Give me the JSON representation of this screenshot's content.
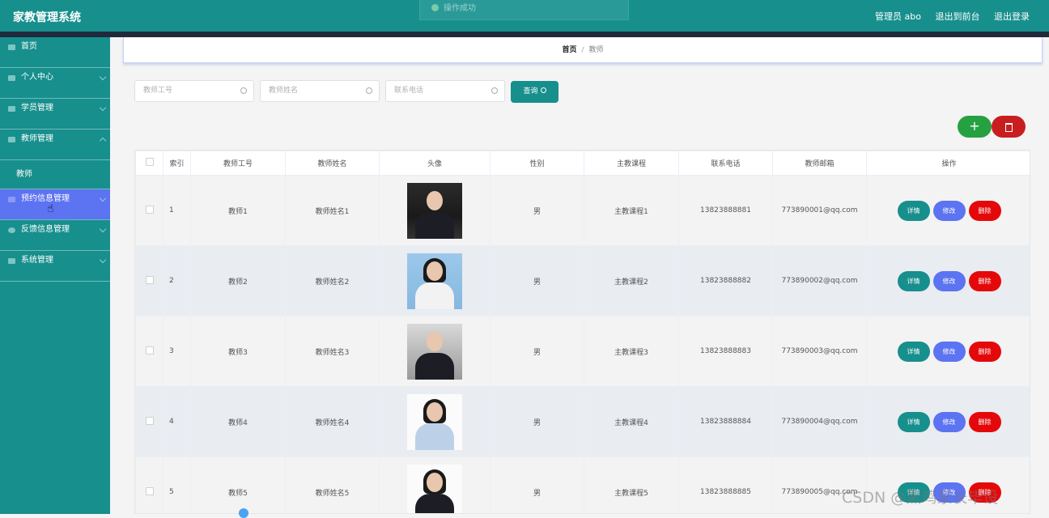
{
  "app": {
    "title": "家教管理系统",
    "toast": "操作成功",
    "header_links": [
      "管理员 abo",
      "退出到前台",
      "退出登录"
    ]
  },
  "sidebar": {
    "items": [
      {
        "label": "首页",
        "icon": "home-icon",
        "active": false
      },
      {
        "label": "个人中心",
        "icon": "user-icon",
        "active": false
      },
      {
        "label": "学员管理",
        "icon": "student-icon",
        "active": false
      },
      {
        "label": "教师管理",
        "icon": "teacher-icon",
        "active": false
      },
      {
        "label": "教师",
        "icon": "",
        "active": false,
        "sub": true
      },
      {
        "label": "预约信息管理",
        "icon": "calendar-icon",
        "active": true
      },
      {
        "label": "反馈信息管理",
        "icon": "feedback-icon",
        "active": false
      },
      {
        "label": "系统管理",
        "icon": "settings-icon",
        "active": false
      }
    ]
  },
  "breadcrumb": {
    "home": "首页",
    "separator": "/",
    "current": "教师"
  },
  "search": {
    "teacher_id_placeholder": "教师工号",
    "teacher_name_placeholder": "教师姓名",
    "phone_placeholder": "联系电话",
    "query_label": "查询"
  },
  "toolbar": {
    "add_label": "+"
  },
  "table": {
    "headers": [
      "",
      "索引",
      "教师工号",
      "教师姓名",
      "头像",
      "性别",
      "主教课程",
      "联系电话",
      "教师邮箱",
      "操作"
    ],
    "rows": [
      {
        "index": "1",
        "teacher_id": "教师1",
        "name": "教师姓名1",
        "avatar": "dark",
        "gender": "男",
        "course": "主教课程1",
        "phone": "13823888881",
        "email": "773890001@qq.com"
      },
      {
        "index": "2",
        "teacher_id": "教师2",
        "name": "教师姓名2",
        "avatar": "blue",
        "gender": "男",
        "course": "主教课程2",
        "phone": "13823888882",
        "email": "773890002@qq.com"
      },
      {
        "index": "3",
        "teacher_id": "教师3",
        "name": "教师姓名3",
        "avatar": "grey",
        "gender": "男",
        "course": "主教课程3",
        "phone": "13823888883",
        "email": "773890003@qq.com"
      },
      {
        "index": "4",
        "teacher_id": "教师4",
        "name": "教师姓名4",
        "avatar": "white",
        "gender": "男",
        "course": "主教课程4",
        "phone": "13823888884",
        "email": "773890004@qq.com"
      },
      {
        "index": "5",
        "teacher_id": "教师5",
        "name": "教师姓名5",
        "avatar": "white",
        "gender": "男",
        "course": "主教课程5",
        "phone": "13823888885",
        "email": "773890005@qq.com"
      }
    ],
    "actions": {
      "detail": "详情",
      "edit": "修改",
      "delete": "删除"
    }
  },
  "watermark": "CSDN @黑鸡家长毕设"
}
